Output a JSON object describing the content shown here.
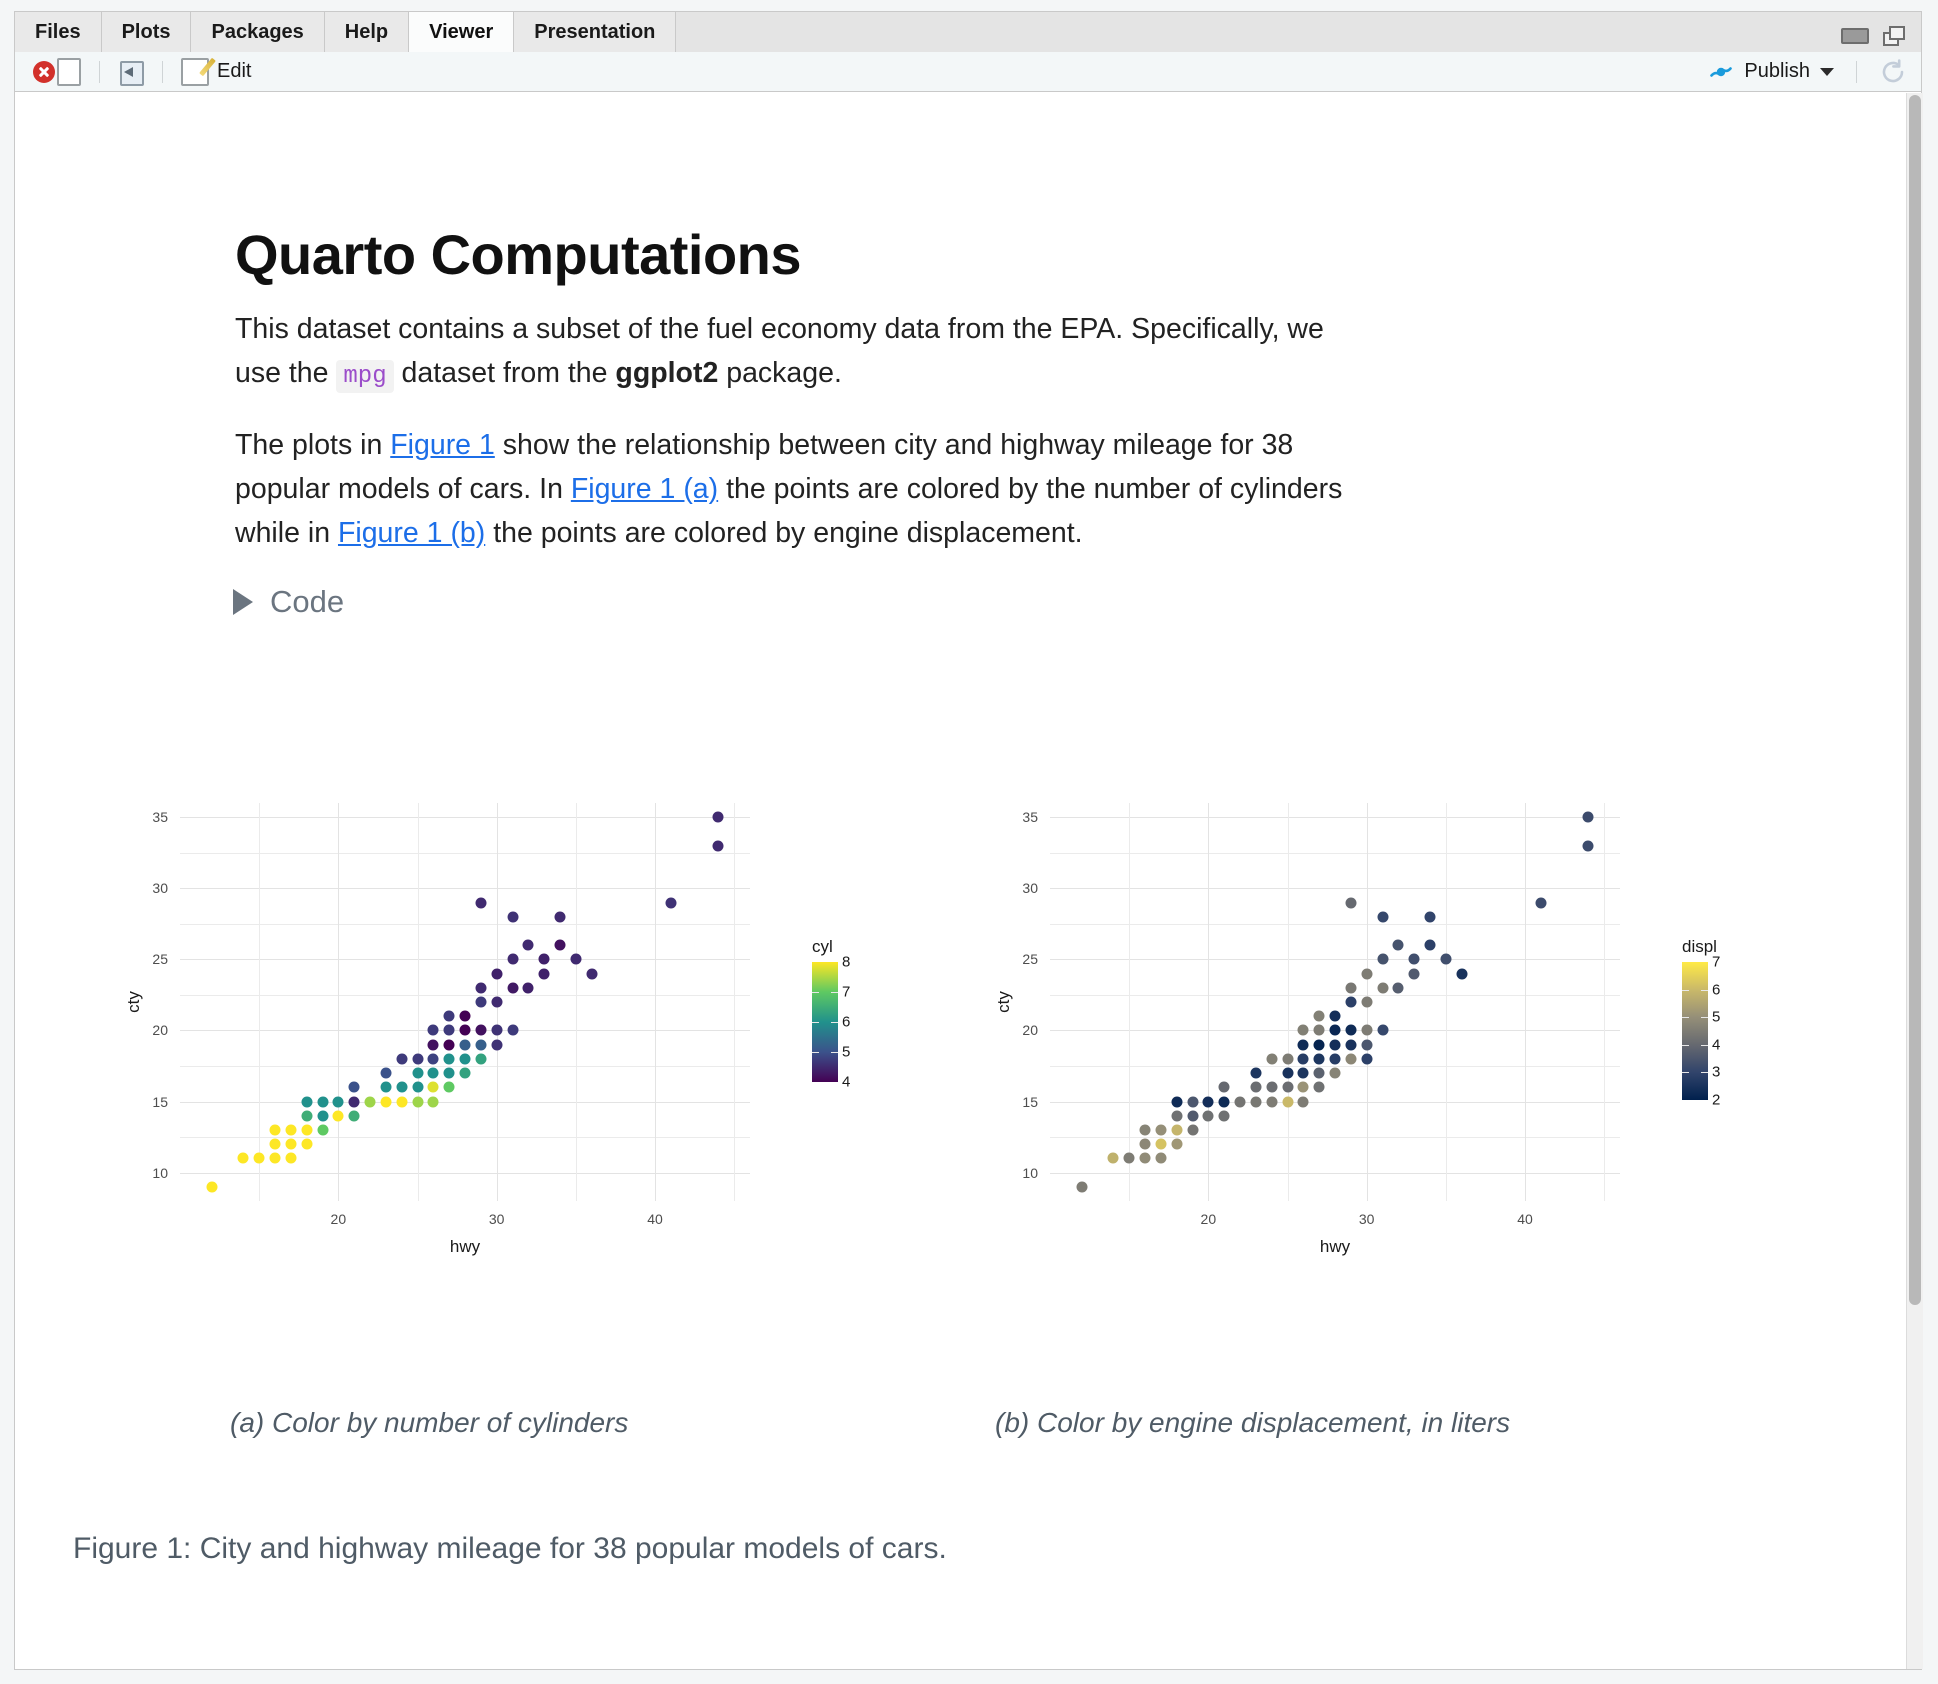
{
  "window": {
    "tabs": [
      {
        "label": "Files",
        "active": false
      },
      {
        "label": "Plots",
        "active": false
      },
      {
        "label": "Packages",
        "active": false
      },
      {
        "label": "Help",
        "active": false
      },
      {
        "label": "Viewer",
        "active": true
      },
      {
        "label": "Presentation",
        "active": false
      }
    ],
    "minimize_icon": "minimize-icon",
    "maximize_icon": "maximize-icon"
  },
  "toolbar": {
    "stop_icon": "stop-icon",
    "popout_icon": "show-in-new-window-icon",
    "edit_icon": "edit-icon",
    "edit_label": "Edit",
    "publish_icon": "publish-icon",
    "publish_label": "Publish",
    "publish_caret": "chevron-down-icon",
    "refresh_icon": "refresh-icon"
  },
  "document": {
    "title": "Quarto Computations",
    "paragraph1": {
      "part1": "This dataset contains a subset of the fuel economy data from the EPA. Specifically, we use the ",
      "code": "mpg",
      "part2": " dataset from the ",
      "bold": "ggplot2",
      "part3": " package."
    },
    "paragraph2": {
      "part1": "The plots in ",
      "link1": "Figure 1",
      "part2": " show the relationship between city and highway mileage for 38 popular models of cars. In ",
      "link2": "Figure 1 (a)",
      "part3": " the points are colored by the number of cylinders while in ",
      "link3": "Figure 1 (b)",
      "part4": " the points are colored by engine displacement."
    },
    "code_toggle": {
      "label": "Code",
      "icon": "triangle-right-icon"
    },
    "subcaption_a": "(a) Color by number of cylinders",
    "subcaption_b": "(b) Color by engine displacement, in liters",
    "figure_caption": "Figure 1: City and highway mileage for 38 popular models of cars."
  },
  "chart_data": [
    {
      "id": "panel-a",
      "type": "scatter",
      "title": "",
      "xlabel": "hwy",
      "ylabel": "cty",
      "xlim": [
        10,
        46
      ],
      "ylim": [
        8,
        36
      ],
      "xticks": [
        20,
        30,
        40
      ],
      "yticks": [
        10,
        15,
        20,
        25,
        30,
        35
      ],
      "grid": true,
      "legend": {
        "title": "cyl",
        "position": "right",
        "colormap": "viridis",
        "ticks": [
          8,
          7,
          6,
          5,
          4
        ],
        "vmin": 4,
        "vmax": 8,
        "gradient": [
          "#440154",
          "#3b528b",
          "#21918c",
          "#5ec962",
          "#fde725"
        ]
      },
      "color_key": "cyl",
      "points": [
        {
          "x": 12,
          "y": 9,
          "c": 8
        },
        {
          "x": 14,
          "y": 11,
          "c": 8
        },
        {
          "x": 15,
          "y": 11,
          "c": 8
        },
        {
          "x": 16,
          "y": 11,
          "c": 8
        },
        {
          "x": 17,
          "y": 11,
          "c": 8
        },
        {
          "x": 16,
          "y": 12,
          "c": 8
        },
        {
          "x": 17,
          "y": 12,
          "c": 8
        },
        {
          "x": 18,
          "y": 12,
          "c": 8
        },
        {
          "x": 16,
          "y": 13,
          "c": 8
        },
        {
          "x": 17,
          "y": 13,
          "c": 8
        },
        {
          "x": 18,
          "y": 13,
          "c": 8
        },
        {
          "x": 19,
          "y": 13,
          "c": 7
        },
        {
          "x": 18,
          "y": 14,
          "c": 6.5
        },
        {
          "x": 19,
          "y": 14,
          "c": 6
        },
        {
          "x": 20,
          "y": 14,
          "c": 8
        },
        {
          "x": 21,
          "y": 14,
          "c": 6.5
        },
        {
          "x": 18,
          "y": 15,
          "c": 6
        },
        {
          "x": 19,
          "y": 15,
          "c": 6
        },
        {
          "x": 20,
          "y": 15,
          "c": 6
        },
        {
          "x": 21,
          "y": 15,
          "c": 4.5
        },
        {
          "x": 22,
          "y": 15,
          "c": 7.4
        },
        {
          "x": 23,
          "y": 15,
          "c": 8
        },
        {
          "x": 24,
          "y": 15,
          "c": 8
        },
        {
          "x": 25,
          "y": 15,
          "c": 7.4
        },
        {
          "x": 26,
          "y": 15,
          "c": 7.4
        },
        {
          "x": 21,
          "y": 16,
          "c": 5
        },
        {
          "x": 23,
          "y": 16,
          "c": 6
        },
        {
          "x": 24,
          "y": 16,
          "c": 6
        },
        {
          "x": 25,
          "y": 16,
          "c": 6
        },
        {
          "x": 26,
          "y": 16,
          "c": 7.8
        },
        {
          "x": 27,
          "y": 16,
          "c": 7
        },
        {
          "x": 23,
          "y": 17,
          "c": 5
        },
        {
          "x": 25,
          "y": 17,
          "c": 6
        },
        {
          "x": 26,
          "y": 17,
          "c": 6
        },
        {
          "x": 27,
          "y": 17,
          "c": 6
        },
        {
          "x": 28,
          "y": 17,
          "c": 6.3
        },
        {
          "x": 24,
          "y": 18,
          "c": 4.7
        },
        {
          "x": 25,
          "y": 18,
          "c": 4.7
        },
        {
          "x": 26,
          "y": 18,
          "c": 4.8
        },
        {
          "x": 27,
          "y": 18,
          "c": 6
        },
        {
          "x": 28,
          "y": 18,
          "c": 6
        },
        {
          "x": 29,
          "y": 18,
          "c": 6.3
        },
        {
          "x": 26,
          "y": 19,
          "c": 4.2
        },
        {
          "x": 27,
          "y": 19,
          "c": 4
        },
        {
          "x": 28,
          "y": 19,
          "c": 5.2
        },
        {
          "x": 29,
          "y": 19,
          "c": 5.2
        },
        {
          "x": 30,
          "y": 19,
          "c": 4.6
        },
        {
          "x": 26,
          "y": 20,
          "c": 4.7
        },
        {
          "x": 27,
          "y": 20,
          "c": 4.7
        },
        {
          "x": 28,
          "y": 20,
          "c": 4
        },
        {
          "x": 29,
          "y": 20,
          "c": 4.2
        },
        {
          "x": 30,
          "y": 20,
          "c": 4.6
        },
        {
          "x": 31,
          "y": 20,
          "c": 4.7
        },
        {
          "x": 27,
          "y": 21,
          "c": 4.7
        },
        {
          "x": 28,
          "y": 21,
          "c": 4
        },
        {
          "x": 29,
          "y": 22,
          "c": 4.7
        },
        {
          "x": 30,
          "y": 22,
          "c": 4.5
        },
        {
          "x": 29,
          "y": 23,
          "c": 4.5
        },
        {
          "x": 31,
          "y": 23,
          "c": 4.3
        },
        {
          "x": 32,
          "y": 23,
          "c": 4.4
        },
        {
          "x": 30,
          "y": 24,
          "c": 4.4
        },
        {
          "x": 33,
          "y": 24,
          "c": 4.4
        },
        {
          "x": 36,
          "y": 24,
          "c": 4.5
        },
        {
          "x": 31,
          "y": 25,
          "c": 4.5
        },
        {
          "x": 33,
          "y": 25,
          "c": 4.4
        },
        {
          "x": 35,
          "y": 25,
          "c": 4.5
        },
        {
          "x": 32,
          "y": 26,
          "c": 4.5
        },
        {
          "x": 34,
          "y": 26,
          "c": 4.2
        },
        {
          "x": 31,
          "y": 28,
          "c": 4.6
        },
        {
          "x": 34,
          "y": 28,
          "c": 4.5
        },
        {
          "x": 29,
          "y": 29,
          "c": 4.5
        },
        {
          "x": 41,
          "y": 29,
          "c": 4.6
        },
        {
          "x": 44,
          "y": 33,
          "c": 4.5
        },
        {
          "x": 44,
          "y": 35,
          "c": 4.5
        }
      ]
    },
    {
      "id": "panel-b",
      "type": "scatter",
      "title": "",
      "xlabel": "hwy",
      "ylabel": "cty",
      "xlim": [
        10,
        46
      ],
      "ylim": [
        8,
        36
      ],
      "xticks": [
        20,
        30,
        40
      ],
      "yticks": [
        10,
        15,
        20,
        25,
        30,
        35
      ],
      "grid": true,
      "legend": {
        "title": "displ",
        "position": "right",
        "colormap": "cividis",
        "ticks": [
          7,
          6,
          5,
          4,
          3,
          2
        ],
        "vmin": 2,
        "vmax": 7,
        "gradient": [
          "#00204d",
          "#31446b",
          "#666970",
          "#958f78",
          "#cab969",
          "#ffea46"
        ]
      },
      "color_key": "displ",
      "points": [
        {
          "x": 12,
          "y": 9,
          "c": 4.5
        },
        {
          "x": 14,
          "y": 11,
          "c": 5.8
        },
        {
          "x": 15,
          "y": 11,
          "c": 4.5
        },
        {
          "x": 16,
          "y": 11,
          "c": 4.9
        },
        {
          "x": 17,
          "y": 11,
          "c": 4.9
        },
        {
          "x": 16,
          "y": 12,
          "c": 4.8
        },
        {
          "x": 17,
          "y": 12,
          "c": 6.2
        },
        {
          "x": 18,
          "y": 12,
          "c": 5.2
        },
        {
          "x": 16,
          "y": 13,
          "c": 4.7
        },
        {
          "x": 17,
          "y": 13,
          "c": 5.0
        },
        {
          "x": 18,
          "y": 13,
          "c": 5.9
        },
        {
          "x": 19,
          "y": 13,
          "c": 4.3
        },
        {
          "x": 18,
          "y": 14,
          "c": 4.2
        },
        {
          "x": 19,
          "y": 14,
          "c": 3.6
        },
        {
          "x": 20,
          "y": 14,
          "c": 4.2
        },
        {
          "x": 21,
          "y": 14,
          "c": 4.2
        },
        {
          "x": 18,
          "y": 15,
          "c": 2.3
        },
        {
          "x": 19,
          "y": 15,
          "c": 3.5
        },
        {
          "x": 20,
          "y": 15,
          "c": 2.4
        },
        {
          "x": 21,
          "y": 15,
          "c": 2.3
        },
        {
          "x": 22,
          "y": 15,
          "c": 4.3
        },
        {
          "x": 23,
          "y": 15,
          "c": 4.4
        },
        {
          "x": 24,
          "y": 15,
          "c": 4.5
        },
        {
          "x": 25,
          "y": 15,
          "c": 6.0
        },
        {
          "x": 26,
          "y": 15,
          "c": 4.5
        },
        {
          "x": 21,
          "y": 16,
          "c": 4.0
        },
        {
          "x": 23,
          "y": 16,
          "c": 4.1
        },
        {
          "x": 24,
          "y": 16,
          "c": 4.1
        },
        {
          "x": 25,
          "y": 16,
          "c": 4.1
        },
        {
          "x": 26,
          "y": 16,
          "c": 5.1
        },
        {
          "x": 27,
          "y": 16,
          "c": 4.2
        },
        {
          "x": 23,
          "y": 17,
          "c": 2.6
        },
        {
          "x": 25,
          "y": 17,
          "c": 2.5
        },
        {
          "x": 26,
          "y": 17,
          "c": 2.6
        },
        {
          "x": 27,
          "y": 17,
          "c": 3.8
        },
        {
          "x": 28,
          "y": 17,
          "c": 4.7
        },
        {
          "x": 24,
          "y": 18,
          "c": 4.6
        },
        {
          "x": 25,
          "y": 18,
          "c": 4.5
        },
        {
          "x": 26,
          "y": 18,
          "c": 2.8
        },
        {
          "x": 27,
          "y": 18,
          "c": 2.6
        },
        {
          "x": 28,
          "y": 18,
          "c": 2.8
        },
        {
          "x": 29,
          "y": 18,
          "c": 4.8
        },
        {
          "x": 30,
          "y": 18,
          "c": 2.9
        },
        {
          "x": 26,
          "y": 19,
          "c": 2.3
        },
        {
          "x": 27,
          "y": 19,
          "c": 2.1
        },
        {
          "x": 28,
          "y": 19,
          "c": 2.4
        },
        {
          "x": 29,
          "y": 19,
          "c": 2.5
        },
        {
          "x": 30,
          "y": 19,
          "c": 3.5
        },
        {
          "x": 26,
          "y": 20,
          "c": 4.6
        },
        {
          "x": 27,
          "y": 20,
          "c": 4.5
        },
        {
          "x": 28,
          "y": 20,
          "c": 2.2
        },
        {
          "x": 29,
          "y": 20,
          "c": 2.3
        },
        {
          "x": 30,
          "y": 20,
          "c": 4.5
        },
        {
          "x": 31,
          "y": 20,
          "c": 3.1
        },
        {
          "x": 27,
          "y": 21,
          "c": 4.6
        },
        {
          "x": 28,
          "y": 21,
          "c": 2.4
        },
        {
          "x": 29,
          "y": 22,
          "c": 2.9
        },
        {
          "x": 30,
          "y": 22,
          "c": 4.5
        },
        {
          "x": 29,
          "y": 23,
          "c": 4.4
        },
        {
          "x": 31,
          "y": 23,
          "c": 4.5
        },
        {
          "x": 32,
          "y": 23,
          "c": 3.7
        },
        {
          "x": 30,
          "y": 24,
          "c": 4.5
        },
        {
          "x": 33,
          "y": 24,
          "c": 3.6
        },
        {
          "x": 36,
          "y": 24,
          "c": 2.5
        },
        {
          "x": 31,
          "y": 25,
          "c": 3.4
        },
        {
          "x": 33,
          "y": 25,
          "c": 3.3
        },
        {
          "x": 35,
          "y": 25,
          "c": 3.3
        },
        {
          "x": 32,
          "y": 26,
          "c": 3.4
        },
        {
          "x": 34,
          "y": 26,
          "c": 2.9
        },
        {
          "x": 31,
          "y": 28,
          "c": 3.1
        },
        {
          "x": 34,
          "y": 28,
          "c": 3.0
        },
        {
          "x": 29,
          "y": 29,
          "c": 4.0
        },
        {
          "x": 41,
          "y": 29,
          "c": 3.2
        },
        {
          "x": 44,
          "y": 33,
          "c": 3.2
        },
        {
          "x": 44,
          "y": 35,
          "c": 3.2
        }
      ]
    }
  ]
}
